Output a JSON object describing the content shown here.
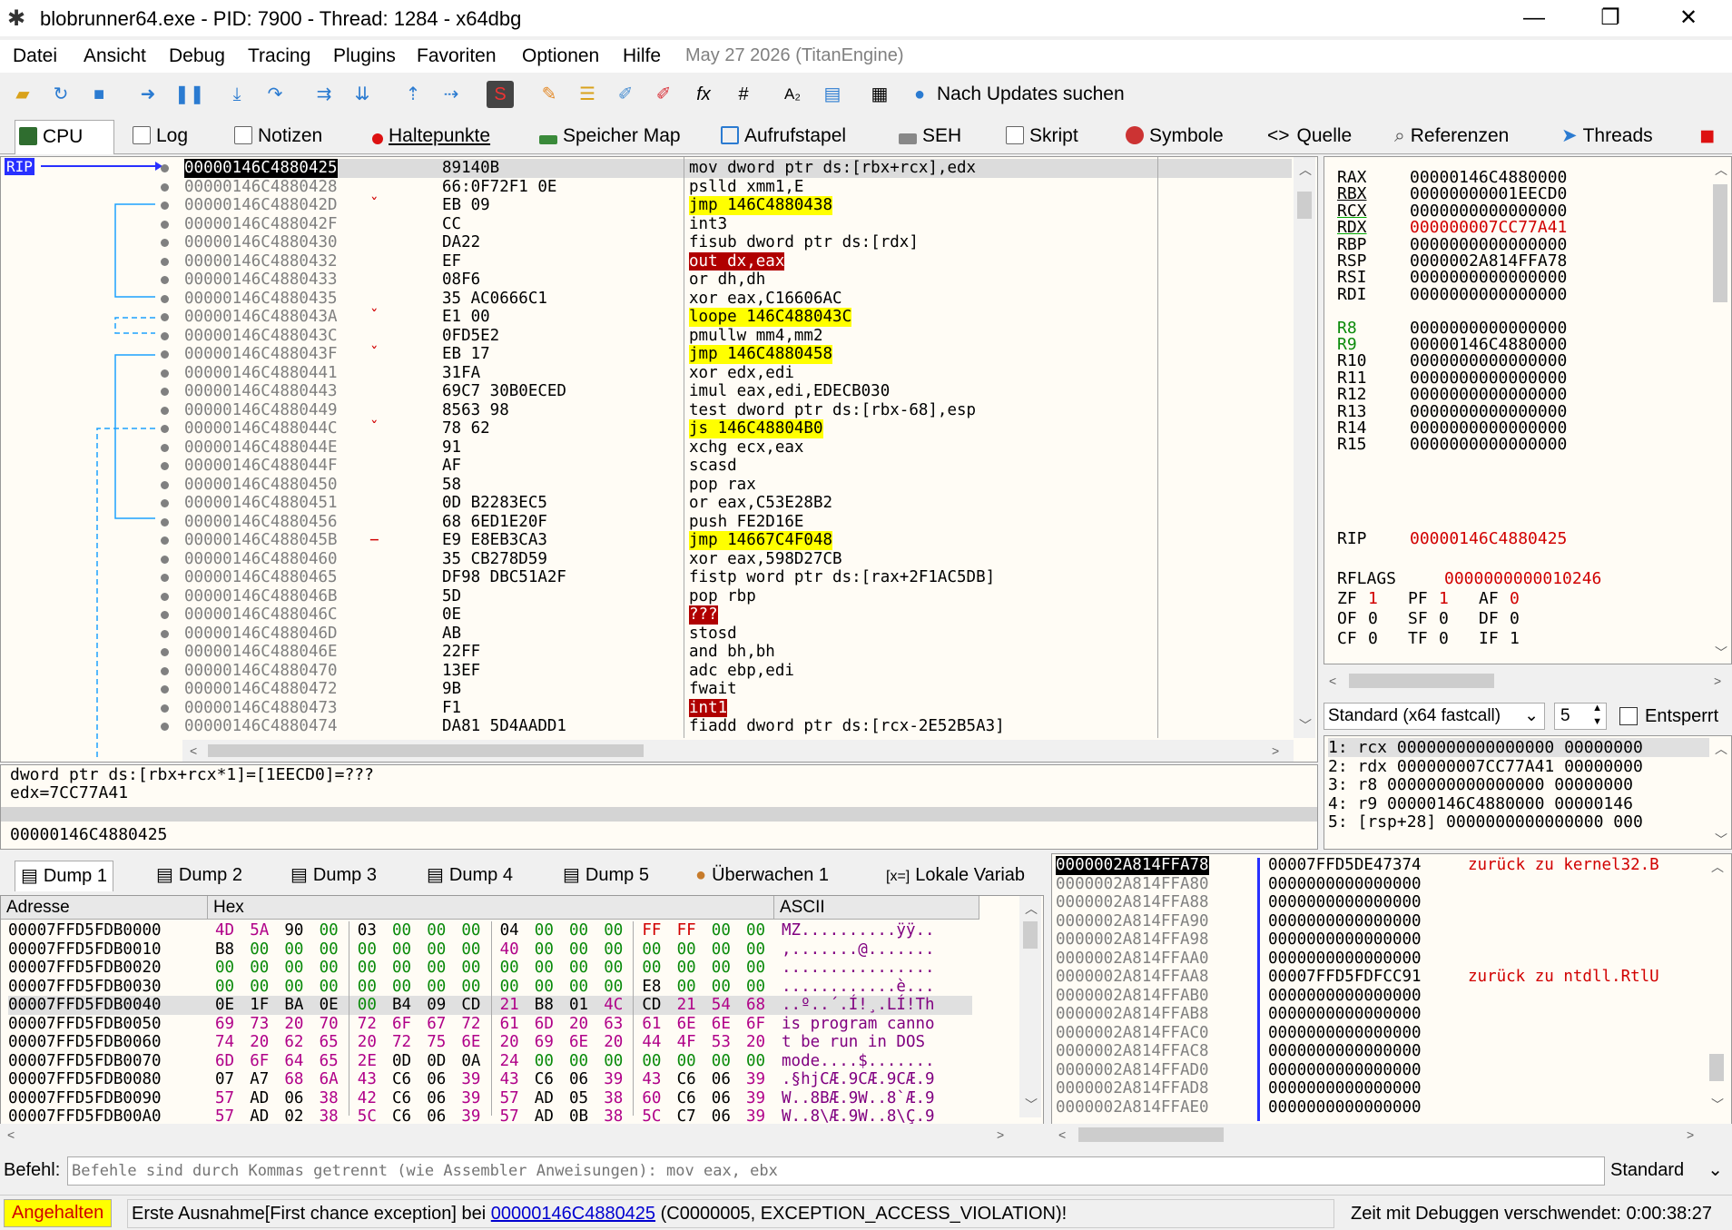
{
  "window": {
    "title": "blobrunner64.exe - PID: 7900 - Thread: 1284 - x64dbg",
    "minimize": "—",
    "restore": "❐",
    "close": "✕"
  },
  "menu": {
    "items": [
      "Datei",
      "Ansicht",
      "Debug",
      "Tracing",
      "Plugins",
      "Favoriten",
      "Optionen",
      "Hilfe"
    ],
    "date": "May 27 2026 (TitanEngine)"
  },
  "toolbar": {
    "update_label": "Nach Updates suchen"
  },
  "tabs": [
    "CPU",
    "Log",
    "Notizen",
    "Haltepunkte",
    "Speicher Map",
    "Aufrufstapel",
    "SEH",
    "Skript",
    "Symbole",
    "Quelle",
    "Referenzen",
    "Threads"
  ],
  "rip_label": "RIP",
  "disasm": [
    {
      "addr": "00000146C4880425",
      "bytes": "89140B",
      "ins": "mov dword ptr ds:[rbx+rcx],edx",
      "sel": true
    },
    {
      "addr": "00000146C4880428",
      "bytes": "66:0F72F1 0E",
      "ins": "pslld xmm1,E"
    },
    {
      "addr": "00000146C488042D",
      "bytes": "EB 09",
      "ins": "jmp 146C4880438",
      "jump": true
    },
    {
      "addr": "00000146C488042F",
      "bytes": "CC",
      "ins": "int3"
    },
    {
      "addr": "00000146C4880430",
      "bytes": "DA22",
      "ins": "fisub dword ptr ds:[rdx]"
    },
    {
      "addr": "00000146C4880432",
      "bytes": "EF",
      "ins": "out dx,eax",
      "bad": "out"
    },
    {
      "addr": "00000146C4880433",
      "bytes": "08F6",
      "ins": "or dh,dh"
    },
    {
      "addr": "00000146C4880435",
      "bytes": "35 AC0666C1",
      "ins": "xor eax,C16606AC"
    },
    {
      "addr": "00000146C488043A",
      "bytes": "E1 00",
      "ins": "loope 146C488043C",
      "jump": true
    },
    {
      "addr": "00000146C488043C",
      "bytes": "0FD5E2",
      "ins": "pmullw mm4,mm2"
    },
    {
      "addr": "00000146C488043F",
      "bytes": "EB 17",
      "ins": "jmp 146C4880458",
      "jump": true
    },
    {
      "addr": "00000146C4880441",
      "bytes": "31FA",
      "ins": "xor edx,edi"
    },
    {
      "addr": "00000146C4880443",
      "bytes": "69C7 30B0ECED",
      "ins": "imul eax,edi,EDECB030"
    },
    {
      "addr": "00000146C4880449",
      "bytes": "8563 98",
      "ins": "test dword ptr ds:[rbx-68],esp"
    },
    {
      "addr": "00000146C488044C",
      "bytes": "78 62",
      "ins": "js 146C48804B0",
      "jump": true
    },
    {
      "addr": "00000146C488044E",
      "bytes": "91",
      "ins": "xchg ecx,eax"
    },
    {
      "addr": "00000146C488044F",
      "bytes": "AF",
      "ins": "scasd"
    },
    {
      "addr": "00000146C4880450",
      "bytes": "58",
      "ins": "pop rax"
    },
    {
      "addr": "00000146C4880451",
      "bytes": "0D B2283EC5",
      "ins": "or eax,C53E28B2"
    },
    {
      "addr": "00000146C4880456",
      "bytes": "68 6ED1E20F",
      "ins": "push FE2D16E"
    },
    {
      "addr": "00000146C488045B",
      "bytes": "E9 E8EB3CA3",
      "ins": "jmp 14667C4F048",
      "jump": true
    },
    {
      "addr": "00000146C4880460",
      "bytes": "35 CB278D59",
      "ins": "xor eax,598D27CB"
    },
    {
      "addr": "00000146C4880465",
      "bytes": "DF98 DBC51A2F",
      "ins": "fistp word ptr ds:[rax+2F1AC5DB]"
    },
    {
      "addr": "00000146C488046B",
      "bytes": "5D",
      "ins": "pop rbp"
    },
    {
      "addr": "00000146C488046C",
      "bytes": "0E",
      "ins": "???",
      "bad": "???"
    },
    {
      "addr": "00000146C488046D",
      "bytes": "AB",
      "ins": "stosd"
    },
    {
      "addr": "00000146C488046E",
      "bytes": "22FF",
      "ins": "and bh,bh"
    },
    {
      "addr": "00000146C4880470",
      "bytes": "13EF",
      "ins": "adc ebp,edi"
    },
    {
      "addr": "00000146C4880472",
      "bytes": "9B",
      "ins": "fwait"
    },
    {
      "addr": "00000146C4880473",
      "bytes": "F1",
      "ins": "int1",
      "bad": "int1"
    },
    {
      "addr": "00000146C4880474",
      "bytes": "DA81 5D4AADD1",
      "ins": "fiadd dword ptr ds:[rcx-2E52B5A3]"
    }
  ],
  "registers": [
    {
      "name": "RAX",
      "value": "00000146C4880000"
    },
    {
      "name": "RBX",
      "value": "00000000001EECD0"
    },
    {
      "name": "RCX",
      "value": "0000000000000000"
    },
    {
      "name": "RDX",
      "value": "000000007CC77A41",
      "changed": true
    },
    {
      "name": "RBP",
      "value": "0000000000000000"
    },
    {
      "name": "RSP",
      "value": "0000002A814FFA78"
    },
    {
      "name": "RSI",
      "value": "0000000000000000"
    },
    {
      "name": "RDI",
      "value": "0000000000000000"
    },
    {
      "name": "R8",
      "value": "0000000000000000"
    },
    {
      "name": "R9",
      "value": "00000146C4880000"
    },
    {
      "name": "R10",
      "value": "0000000000000000"
    },
    {
      "name": "R11",
      "value": "0000000000000000"
    },
    {
      "name": "R12",
      "value": "0000000000000000"
    },
    {
      "name": "R13",
      "value": "0000000000000000"
    },
    {
      "name": "R14",
      "value": "0000000000000000"
    },
    {
      "name": "R15",
      "value": "0000000000000000"
    }
  ],
  "rip": {
    "name": "RIP",
    "value": "00000146C4880425"
  },
  "rflags": {
    "name": "RFLAGS",
    "value": "0000000000010246"
  },
  "flags": [
    [
      "ZF",
      "1"
    ],
    [
      "PF",
      "1"
    ],
    [
      "AF",
      "0"
    ],
    [
      "OF",
      "0"
    ],
    [
      "SF",
      "0"
    ],
    [
      "DF",
      "0"
    ],
    [
      "CF",
      "0"
    ],
    [
      "TF",
      "0"
    ],
    [
      "IF",
      "1"
    ]
  ],
  "callconv": {
    "selected": "Standard (x64 fastcall)",
    "count": "5",
    "unlock": "Entsperrt"
  },
  "args": [
    "1: rcx 0000000000000000 00000000",
    "2: rdx 000000007CC77A41 00000000",
    "3: r8 0000000000000000 00000000",
    "4: r9 00000146C4880000 00000146",
    "5: [rsp+28] 0000000000000000 000"
  ],
  "info": {
    "line1": "dword ptr ds:[rbx+rcx*1]=[1EECD0]=???",
    "line2": "edx=7CC77A41",
    "line3": "00000146C4880425"
  },
  "dumptabs": [
    "Dump 1",
    "Dump 2",
    "Dump 3",
    "Dump 4",
    "Dump 5",
    "Überwachen 1",
    "Lokale Variab"
  ],
  "dump": {
    "headers": [
      "Adresse",
      "Hex",
      "ASCII"
    ],
    "rows": [
      {
        "addr": "00007FFD5FDB0000",
        "hex": [
          "4D",
          "5A",
          "90",
          "00",
          "03",
          "00",
          "00",
          "00",
          "04",
          "00",
          "00",
          "00",
          "FF",
          "FF",
          "00",
          "00"
        ],
        "ascii": "MZ..........ÿÿ.."
      },
      {
        "addr": "00007FFD5FDB0010",
        "hex": [
          "B8",
          "00",
          "00",
          "00",
          "00",
          "00",
          "00",
          "00",
          "40",
          "00",
          "00",
          "00",
          "00",
          "00",
          "00",
          "00"
        ],
        "ascii": ",.......@......."
      },
      {
        "addr": "00007FFD5FDB0020",
        "hex": [
          "00",
          "00",
          "00",
          "00",
          "00",
          "00",
          "00",
          "00",
          "00",
          "00",
          "00",
          "00",
          "00",
          "00",
          "00",
          "00"
        ],
        "ascii": "................"
      },
      {
        "addr": "00007FFD5FDB0030",
        "hex": [
          "00",
          "00",
          "00",
          "00",
          "00",
          "00",
          "00",
          "00",
          "00",
          "00",
          "00",
          "00",
          "E8",
          "00",
          "00",
          "00"
        ],
        "ascii": "............è..."
      },
      {
        "addr": "00007FFD5FDB0040",
        "hex": [
          "0E",
          "1F",
          "BA",
          "0E",
          "00",
          "B4",
          "09",
          "CD",
          "21",
          "B8",
          "01",
          "4C",
          "CD",
          "21",
          "54",
          "68"
        ],
        "ascii": "..º..´.Í!¸.LÍ!Th"
      },
      {
        "addr": "00007FFD5FDB0050",
        "hex": [
          "69",
          "73",
          "20",
          "70",
          "72",
          "6F",
          "67",
          "72",
          "61",
          "6D",
          "20",
          "63",
          "61",
          "6E",
          "6E",
          "6F"
        ],
        "ascii": "is program canno"
      },
      {
        "addr": "00007FFD5FDB0060",
        "hex": [
          "74",
          "20",
          "62",
          "65",
          "20",
          "72",
          "75",
          "6E",
          "20",
          "69",
          "6E",
          "20",
          "44",
          "4F",
          "53",
          "20"
        ],
        "ascii": "t be run in DOS "
      },
      {
        "addr": "00007FFD5FDB0070",
        "hex": [
          "6D",
          "6F",
          "64",
          "65",
          "2E",
          "0D",
          "0D",
          "0A",
          "24",
          "00",
          "00",
          "00",
          "00",
          "00",
          "00",
          "00"
        ],
        "ascii": "mode....$......."
      },
      {
        "addr": "00007FFD5FDB0080",
        "hex": [
          "07",
          "A7",
          "68",
          "6A",
          "43",
          "C6",
          "06",
          "39",
          "43",
          "C6",
          "06",
          "39",
          "43",
          "C6",
          "06",
          "39"
        ],
        "ascii": ".§hjCÆ.9CÆ.9CÆ.9"
      },
      {
        "addr": "00007FFD5FDB0090",
        "hex": [
          "57",
          "AD",
          "06",
          "38",
          "42",
          "C6",
          "06",
          "39",
          "57",
          "AD",
          "05",
          "38",
          "60",
          "C6",
          "06",
          "39"
        ],
        "ascii": "W..8BÆ.9W..8`Æ.9"
      },
      {
        "addr": "00007FFD5FDB00A0",
        "hex": [
          "57",
          "AD",
          "02",
          "38",
          "5C",
          "C6",
          "06",
          "39",
          "57",
          "AD",
          "0B",
          "38",
          "5C",
          "C7",
          "06",
          "39"
        ],
        "ascii": "W..8\\Æ.9W..8\\Ç.9"
      }
    ]
  },
  "stack": [
    {
      "addr": "0000002A814FFA78",
      "value": "00007FFD5DE47374",
      "comment": "zurück zu kernel32.B",
      "sel": true
    },
    {
      "addr": "0000002A814FFA80",
      "value": "0000000000000000"
    },
    {
      "addr": "0000002A814FFA88",
      "value": "0000000000000000"
    },
    {
      "addr": "0000002A814FFA90",
      "value": "0000000000000000"
    },
    {
      "addr": "0000002A814FFA98",
      "value": "0000000000000000"
    },
    {
      "addr": "0000002A814FFAA0",
      "value": "0000000000000000"
    },
    {
      "addr": "0000002A814FFAA8",
      "value": "00007FFD5FDFCC91",
      "comment": "zurück zu ntdll.RtlU"
    },
    {
      "addr": "0000002A814FFAB0",
      "value": "0000000000000000"
    },
    {
      "addr": "0000002A814FFAB8",
      "value": "0000000000000000"
    },
    {
      "addr": "0000002A814FFAC0",
      "value": "0000000000000000"
    },
    {
      "addr": "0000002A814FFAC8",
      "value": "0000000000000000"
    },
    {
      "addr": "0000002A814FFAD0",
      "value": "0000000000000000"
    },
    {
      "addr": "0000002A814FFAD8",
      "value": "0000000000000000"
    },
    {
      "addr": "0000002A814FFAE0",
      "value": "0000000000000000"
    }
  ],
  "cmd": {
    "label": "Befehl:",
    "placeholder": "Befehle sind durch Kommas getrennt (wie Assembler Anweisungen): mov eax, ebx",
    "mode": "Standard"
  },
  "status": {
    "state": "Angehalten",
    "msg_pre": "Erste Ausnahme[First chance exception] bei ",
    "msg_link": "00000146C4880425",
    "msg_post": " (C0000005, EXCEPTION_ACCESS_VIOLATION)!",
    "time": "Zeit mit Debuggen verschwendet: 0:00:38:27"
  }
}
